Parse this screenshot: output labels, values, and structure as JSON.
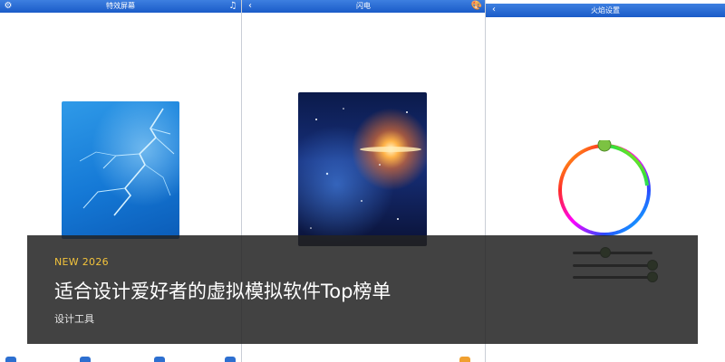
{
  "screens": [
    {
      "title": "特效屏幕",
      "left_icon": "gear-icon",
      "right_icon": "music-note-icon",
      "left_glyph": "⚙",
      "right_glyph": "♫"
    },
    {
      "title": "闪电",
      "left_icon": "back-chevron-icon",
      "right_icon": "palette-icon",
      "left_glyph": "‹",
      "right_glyph": "🎨"
    },
    {
      "title": "火焰设置",
      "left_icon": "back-chevron-icon",
      "left_glyph": "‹"
    }
  ],
  "preview_images": [
    "lightning-wallpaper",
    "galaxy-wallpaper"
  ],
  "color_picker": {
    "hue_ring_colors": [
      "#ff0000",
      "#ffff00",
      "#00ff00",
      "#00ffff",
      "#0000ff",
      "#ff00ff",
      "#ff0000"
    ],
    "knob_color": "#7cc242"
  },
  "overlay": {
    "badge": "NEW 2026",
    "headline": "适合设计爱好者的虚拟模拟软件Top榜单",
    "category": "设计工具"
  },
  "colors": {
    "titlebar": "#2a6fd6",
    "badge": "#f3c33b",
    "overlay_bg": "#232323"
  }
}
